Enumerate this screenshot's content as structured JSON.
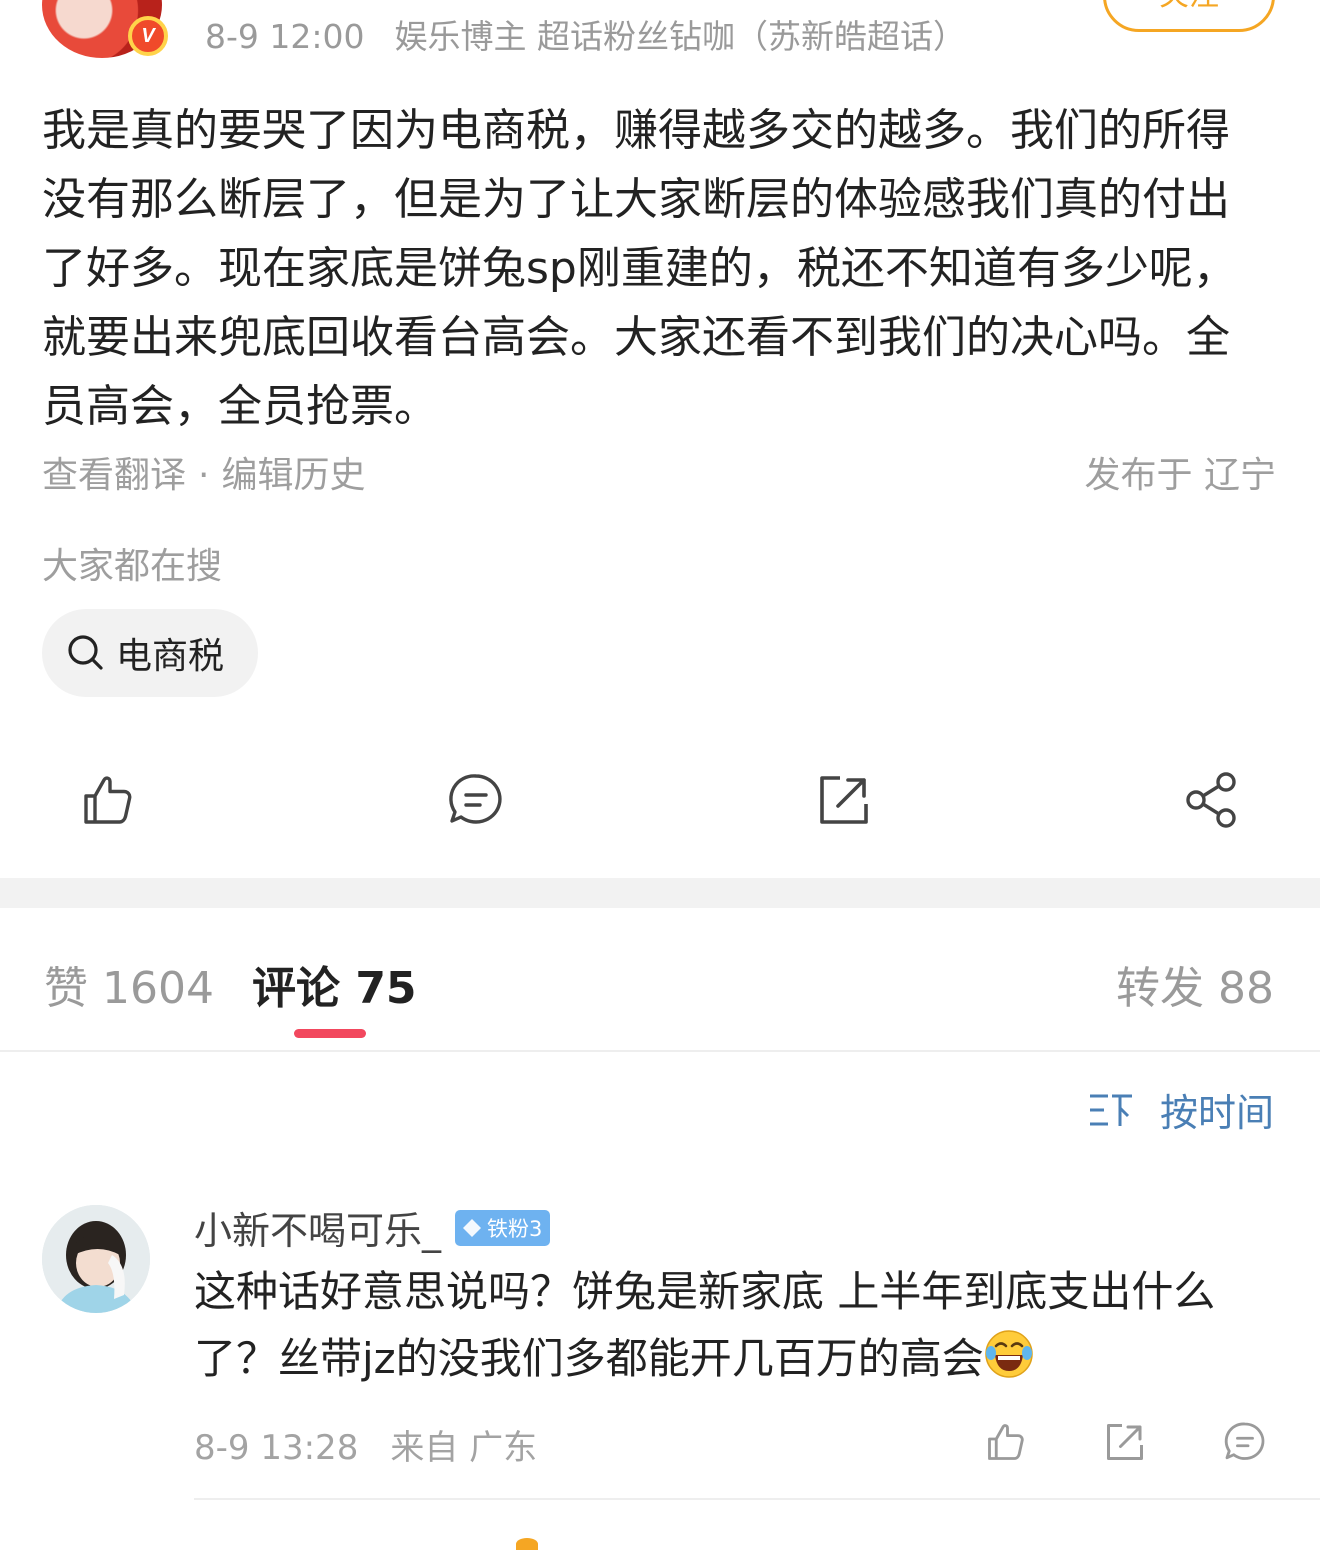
{
  "header": {
    "time": "8-9 12:00",
    "user_tags": "娱乐博主 超话粉丝钻咖（苏新皓超话）",
    "verified_mark": "V",
    "follow_label": "关注"
  },
  "post": {
    "text": "我是真的要哭了因为电商税，赚得越多交的越多。我们的所得没有那么断层了，但是为了让大家断层的体验感我们真的付出了好多。现在家底是饼兔sp刚重建的，税还不知道有多少呢，就要出来兜底回收看台高会。大家还看不到我们的决心吗。全员高会，全员抢票。",
    "view_translation": "查看翻译",
    "separator": "·",
    "edit_history": "编辑历史",
    "published_at": "发布于 辽宁"
  },
  "search": {
    "label": "大家都在搜",
    "chip_text": "电商税",
    "chip_icon": "search-icon"
  },
  "actions": {
    "icons": [
      "thumbs-up-icon",
      "comment-icon",
      "repost-icon",
      "share-icon"
    ]
  },
  "tabs": {
    "likes": "赞 1604",
    "comments": "评论 75",
    "reposts": "转发 88",
    "active_color": "#f2485e"
  },
  "sort": {
    "label": "按时间",
    "icon": "sort-icon",
    "color": "#4a7fb5"
  },
  "comment": {
    "username": "小新不喝可乐_",
    "fan_badge": "铁粉3",
    "text": "这种话好意思说吗？饼兔是新家底 上半年到底支出什么了？丝带jz的没我们多都能开几百万的高会",
    "emoji": "laughing-crying-emoji",
    "time": "8-9 13:28",
    "location": "来自 广东",
    "action_icons": [
      "thumbs-up-icon",
      "repost-icon",
      "comment-icon"
    ]
  }
}
